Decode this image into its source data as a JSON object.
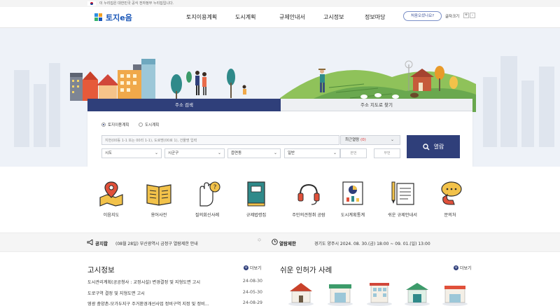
{
  "gov_banner": {
    "text": "이 누리집은 대한민국 공식 전자정부 누리집입니다."
  },
  "header": {
    "logo_text": "토지e음",
    "nav": [
      "토지이용계획",
      "도시계획",
      "규제안내서",
      "고시정보",
      "정보마당"
    ],
    "help_button": "처음오셨나요?",
    "font_size_label": "글자크기",
    "font_plus": "+",
    "font_minus": "-"
  },
  "search": {
    "tabs": [
      "주소 검색",
      "주소 지도로 찾기"
    ],
    "radio": [
      "토지이용계획",
      "도시계획"
    ],
    "address_placeholder": "지번(00동 1-1 또는 00리 1-1), 도로명(00로 1), 건물명 입력",
    "recent_label": "최근열람",
    "recent_count": "(0)",
    "selects": [
      "시도",
      "시군구",
      "읍면동",
      "일반"
    ],
    "bonbun": "본번",
    "bubun": "부번",
    "dash": "-",
    "button": "열람"
  },
  "quick_icons": [
    {
      "label": "이음지도",
      "icon": "map-icon"
    },
    {
      "label": "용어사전",
      "icon": "book-icon"
    },
    {
      "label": "질의회신사례",
      "icon": "question-hand-icon"
    },
    {
      "label": "규제법령집",
      "icon": "law-book-icon"
    },
    {
      "label": "주민의견청취 공람",
      "icon": "headset-icon"
    },
    {
      "label": "도시계획통계",
      "icon": "statistics-icon"
    },
    {
      "label": "쉬운 규제안내서",
      "icon": "document-pen-icon"
    },
    {
      "label": "문의처",
      "icon": "phone-chat-icon"
    }
  ],
  "notice": {
    "title": "공지합",
    "text": "(08월 28일) 부산광역시 금정구 열람제한 안내",
    "arrows": [
      "︿",
      "﹀"
    ],
    "restriction_title": "열람제한",
    "restriction_text": "경기도 양주시 2024. 08. 30.(금) 18:00 ~ 09. 01.(일) 13:00"
  },
  "gosi": {
    "title": "고시정보",
    "more": "더보기",
    "items": [
      {
        "title": "도시관리계획(공공청사 : 교정시설) 변경결정 및 지형도면 고시",
        "date": "24-08-30"
      },
      {
        "title": "도로구역 결정 및 지형도면 고시",
        "date": "24-05-30"
      },
      {
        "title": "영광 충양촌-모가두지구 주거환경개선사업 정비구역 지정 및 정비...",
        "date": "24-08-29"
      }
    ]
  },
  "easy": {
    "title": "쉬운 인허가 사례",
    "more": "더보기"
  },
  "colors": {
    "navy": "#2f3f7a",
    "brand_blue": "#1a57b8",
    "accent_red": "#d33"
  }
}
